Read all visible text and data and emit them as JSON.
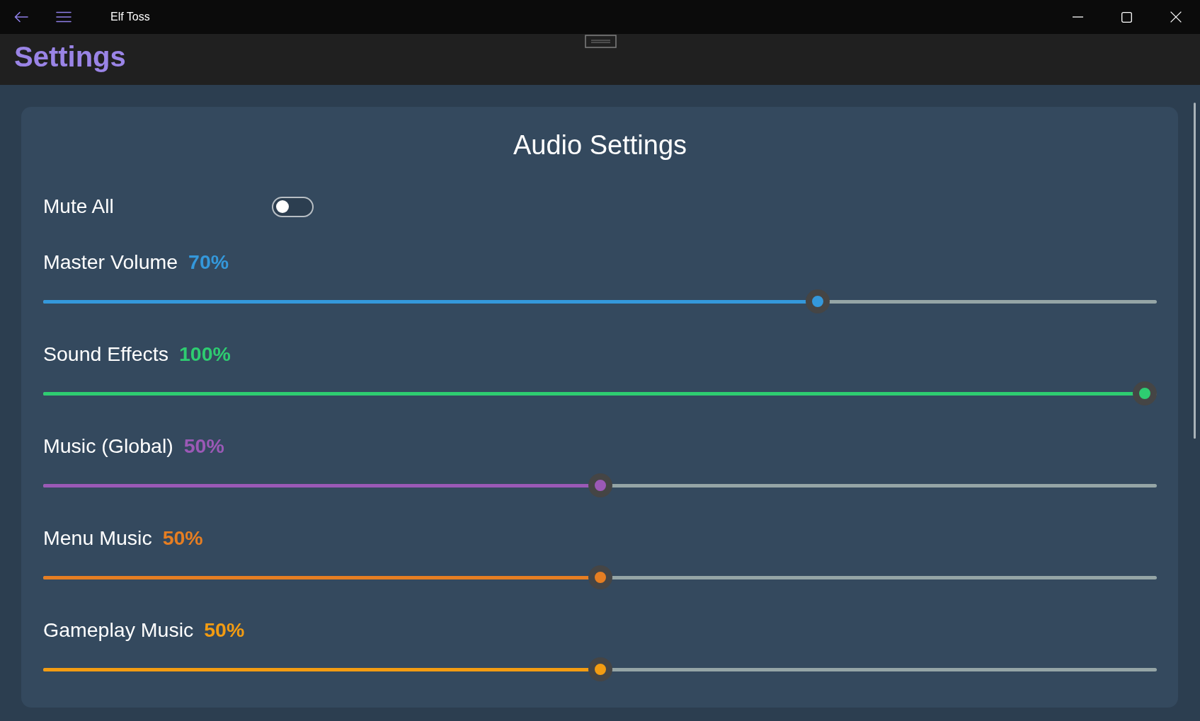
{
  "window": {
    "title": "Elf Toss"
  },
  "header": {
    "title": "Settings"
  },
  "audio_settings": {
    "title": "Audio Settings",
    "mute_all": {
      "label": "Mute All",
      "on": false
    },
    "sliders": [
      {
        "label": "Master Volume",
        "reading": "70%",
        "level": 0.7,
        "color": "#3498db"
      },
      {
        "label": "Sound Effects",
        "reading": "100%",
        "level": 1.0,
        "color": "#2ecc71"
      },
      {
        "label": "Music (Global)",
        "reading": "50%",
        "level": 0.5,
        "color": "#9b59b6"
      },
      {
        "label": "Menu Music",
        "reading": "50%",
        "level": 0.5,
        "color": "#e67e22"
      },
      {
        "label": "Gameplay Music",
        "reading": "50%",
        "level": 0.5,
        "color": "#f39c12"
      }
    ]
  }
}
